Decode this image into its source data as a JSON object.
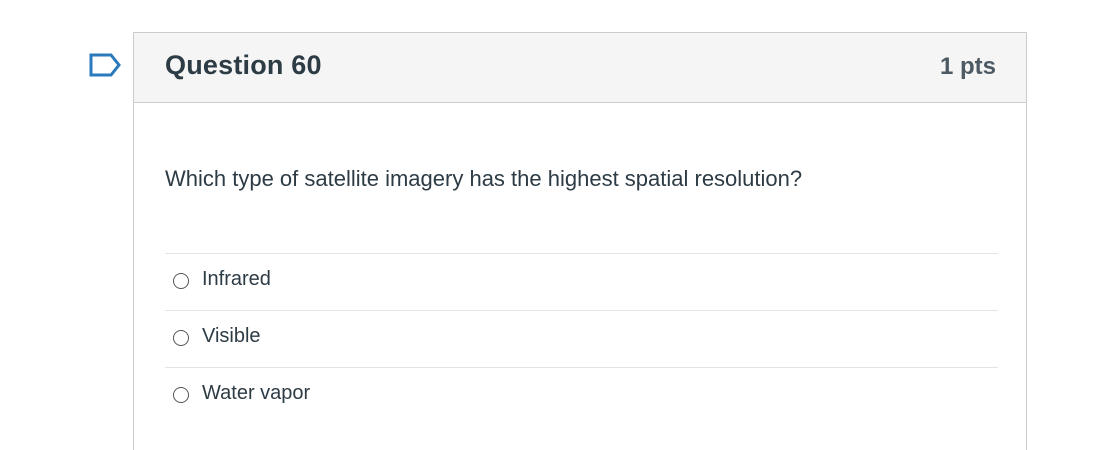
{
  "question": {
    "title": "Question 60",
    "points": "1 pts",
    "text": "Which type of satellite imagery has the highest spatial resolution?",
    "flag_icon": "flag-icon",
    "answers": [
      {
        "label": "Infrared",
        "selected": false
      },
      {
        "label": "Visible",
        "selected": false
      },
      {
        "label": "Water vapor",
        "selected": false
      }
    ]
  },
  "colors": {
    "header_bg": "#f5f5f5",
    "border": "#c7cdd1",
    "text": "#2d3b45",
    "flag": "#2b7abc"
  }
}
